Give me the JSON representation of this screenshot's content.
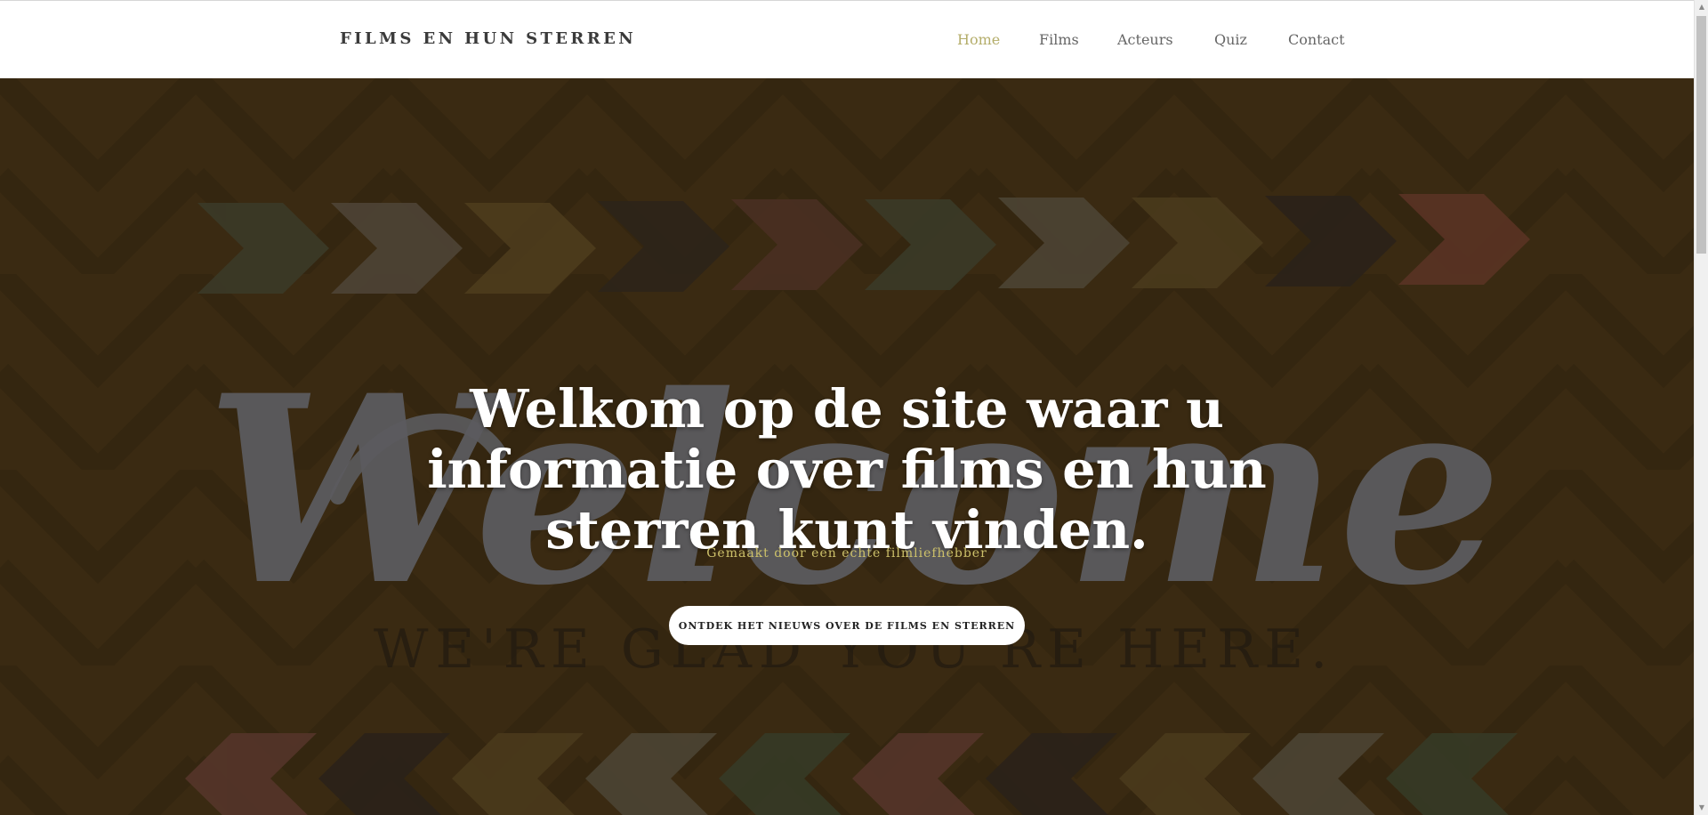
{
  "brand": "FILMS EN HUN STERREN",
  "nav": [
    {
      "label": "Home",
      "active": true
    },
    {
      "label": "Films",
      "active": false
    },
    {
      "label": "Acteurs",
      "active": false
    },
    {
      "label": "Quiz",
      "active": false
    },
    {
      "label": "Contact",
      "active": false
    }
  ],
  "hero": {
    "headline": "Welkom op de site waar u informatie over films en hun sterren kunt vinden.",
    "subline": "Gemaakt door een echte filmliefhebber",
    "cta": "ONTDEK HET NIEUWS OVER DE FILMS EN STERREN",
    "background_art": {
      "script_word": "Welcome",
      "tagline": "WE'RE GLAD YOU'RE HERE."
    }
  },
  "colors": {
    "accent": "#b4ad6a",
    "subline": "#cdc16a",
    "hero_bg": "#3a2a12",
    "nav_text": "#666666"
  },
  "scrollbar": {
    "up_icon": "triangle-up-icon",
    "down_icon": "triangle-down-icon"
  }
}
